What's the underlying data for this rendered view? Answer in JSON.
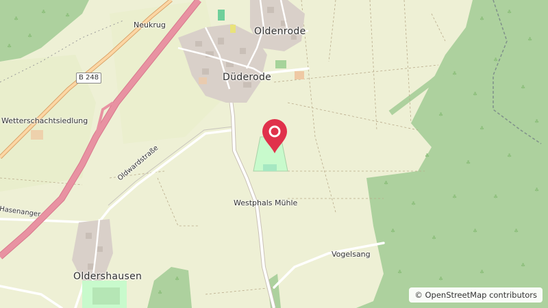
{
  "map": {
    "labels": {
      "oldenrode": "Oldenrode",
      "duderode": "Düderode",
      "neukrug": "Neukrug",
      "wetterschachtsiedlung": "Wetterschachtsiedlung",
      "westphals_muehle": "Westphals Mühle",
      "oldwardstrasse": "Oldwardstraße",
      "hasenanger": "Hasenanger",
      "oldershausen": "Oldershausen",
      "vogelsang": "Vogelsang"
    },
    "road_shield": "B 248",
    "marker": {
      "type": "location-pin",
      "color": "#e0314b"
    },
    "colors": {
      "farmland": "#eef0d5",
      "forest": "#add19e",
      "motorway": "#e892a2",
      "primary_road": "#fcd6a4",
      "builtup": "#d9d0c9",
      "park": "#c8facc"
    }
  },
  "attribution": {
    "symbol": "©",
    "text": "OpenStreetMap contributors"
  }
}
